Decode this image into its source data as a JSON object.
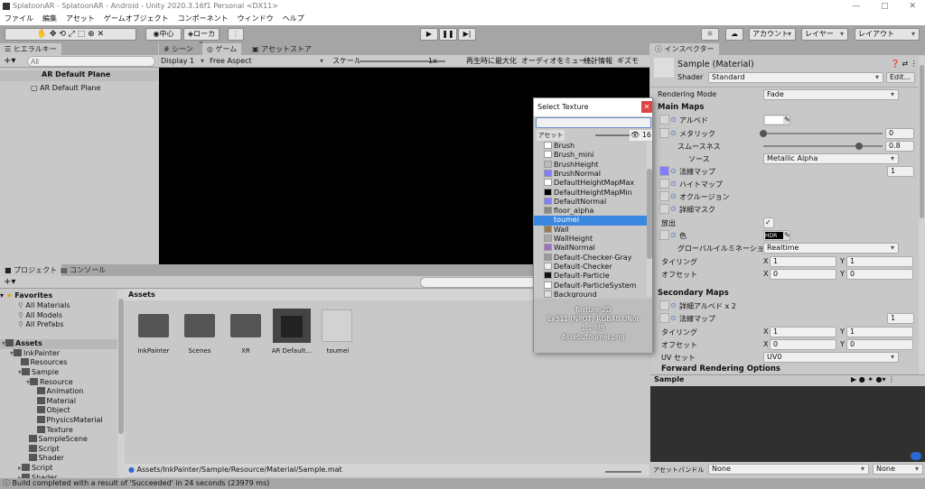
{
  "window": {
    "title": "SplatoonAR - SplatoonAR - Android - Unity 2020.3.16f1 Personal <DX11>"
  },
  "menu": [
    "ファイル",
    "編集",
    "アセット",
    "ゲームオブジェクト",
    "コンポーネント",
    "ウィンドウ",
    "ヘルプ"
  ],
  "toolbar": {
    "pivot": "中心",
    "local": "ローカル",
    "account": "アカウント",
    "layers": "レイヤー",
    "layout": "レイアウト"
  },
  "hierarchy": {
    "tab": "ヒエラルキー",
    "search_placeholder": "All",
    "scene": "AR Default Plane",
    "items": [
      "AR Default Plane"
    ]
  },
  "game": {
    "tabs": [
      "シーン",
      "ゲーム",
      "アセットストア"
    ],
    "display": "Display 1",
    "aspect": "Free Aspect",
    "scale_label": "スケール",
    "scale_value": "1x",
    "buttons": [
      "再生時に最大化",
      "オーディオをミュート",
      "統計情報",
      "ギズモ"
    ]
  },
  "select_texture": {
    "title": "Select Texture",
    "tab": "アセット",
    "visible_count": "16",
    "items": [
      {
        "name": "Brush",
        "color": "#ffffff"
      },
      {
        "name": "Brush_mini",
        "color": "#ffffff"
      },
      {
        "name": "BrushHeight",
        "color": "#bbbbbb"
      },
      {
        "name": "BrushNormal",
        "color": "#7f7fff"
      },
      {
        "name": "DefaultHeightMapMax",
        "color": "#ffffff"
      },
      {
        "name": "DefaultHeightMapMin",
        "color": "#000000"
      },
      {
        "name": "DefaultNormal",
        "color": "#7f7fff"
      },
      {
        "name": "floor_alpha",
        "color": "#888888"
      },
      {
        "name": "toumei",
        "color": "#3f8fe6"
      },
      {
        "name": "Wall",
        "color": "#9a7a4a"
      },
      {
        "name": "WallHeight",
        "color": "#aaaaaa"
      },
      {
        "name": "WallNormal",
        "color": "#a070c0"
      },
      {
        "name": "Default-Checker-Gray",
        "color": "#999999"
      },
      {
        "name": "Default-Checker",
        "color": "#eeeeee"
      },
      {
        "name": "Default-Particle",
        "color": "#111111"
      },
      {
        "name": "Default-ParticleSystem",
        "color": "#ffffff"
      },
      {
        "name": "Background",
        "color": "#dddddd"
      }
    ],
    "selected": "toumei",
    "info": [
      "Texture 2D",
      "1x511 (NPOT)  RGBA8 UNor",
      "1.1 MB",
      "Assets/toumei.png"
    ]
  },
  "inspector": {
    "tab": "インスペクター",
    "name": "Sample (Material)",
    "shader_label": "Shader",
    "shader": "Standard",
    "edit": "Edit...",
    "rendering_mode_label": "Rendering Mode",
    "rendering_mode": "Fade",
    "main_maps": "Main Maps",
    "albedo": "アルベド",
    "metallic": "メタリック",
    "metallic_value": "0",
    "smoothness": "スムースネス",
    "smoothness_value": "0.8",
    "source": "ソース",
    "source_value": "Metallic Alpha",
    "normal": "法線マップ",
    "normal_value": "1",
    "height": "ハイトマップ",
    "occlusion": "オクルージョン",
    "detail_mask": "詳細マスク",
    "emission": "放出",
    "color": "色",
    "hdr": "HDR",
    "gi": "グローバルイルミネーション",
    "gi_value": "Realtime",
    "tiling": "タイリング",
    "offset": "オフセット",
    "x": "X",
    "y": "Y",
    "tiling_x": "1",
    "tiling_y": "1",
    "offset_x": "0",
    "offset_y": "0",
    "secondary_maps": "Secondary Maps",
    "detail_albedo": "詳細アルベド x 2",
    "detail_normal": "法線マップ",
    "detail_normal_value": "1",
    "tiling2_x": "1",
    "tiling2_y": "1",
    "offset2_x": "0",
    "offset2_y": "0",
    "uv_set": "UV セット",
    "uv_value": "UV0",
    "forward": "Forward Rendering Options",
    "preview_title": "Sample",
    "asset_bundle_label": "アセットバンドル",
    "asset_bundle": "None",
    "variant": "None"
  },
  "project": {
    "tabs": [
      "プロジェクト",
      "コンソール"
    ],
    "favorites": "Favorites",
    "favorite_items": [
      "All Materials",
      "All Models",
      "All Prefabs"
    ],
    "tree": [
      {
        "n": "Assets",
        "d": 0
      },
      {
        "n": "InkPainter",
        "d": 1
      },
      {
        "n": "Resources",
        "d": 2
      },
      {
        "n": "Sample",
        "d": 2
      },
      {
        "n": "Resource",
        "d": 3
      },
      {
        "n": "Animation",
        "d": 4
      },
      {
        "n": "Material",
        "d": 4
      },
      {
        "n": "Object",
        "d": 4
      },
      {
        "n": "PhysicsMaterial",
        "d": 4
      },
      {
        "n": "Texture",
        "d": 4
      },
      {
        "n": "SampleScene",
        "d": 3
      },
      {
        "n": "Script",
        "d": 3
      },
      {
        "n": "Shader",
        "d": 3
      },
      {
        "n": "Script",
        "d": 2
      },
      {
        "n": "Shader",
        "d": 2
      }
    ],
    "header": "Assets",
    "assets": [
      "InkPainter",
      "Scenes",
      "XR",
      "AR Default…",
      "toumei"
    ],
    "path": "Assets/InkPainter/Sample/Resource/Material/Sample.mat"
  },
  "status": "Build completed with a result of 'Succeeded' in 24 seconds (23979 ms)"
}
